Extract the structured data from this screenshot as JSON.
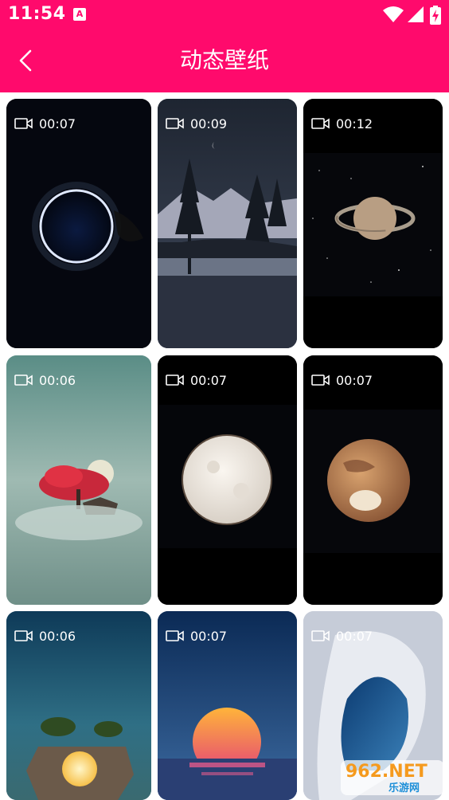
{
  "status_bar": {
    "time": "11:54",
    "notification": "A"
  },
  "header": {
    "title": "动态壁纸"
  },
  "wallpapers": [
    {
      "duration": "00:07",
      "subject": "planet-portal"
    },
    {
      "duration": "00:09",
      "subject": "mountain-lake-night"
    },
    {
      "duration": "00:12",
      "subject": "saturn"
    },
    {
      "duration": "00:06",
      "subject": "red-tree-moon"
    },
    {
      "duration": "00:07",
      "subject": "full-moon"
    },
    {
      "duration": "00:07",
      "subject": "mars"
    },
    {
      "duration": "00:06",
      "subject": "floating-island"
    },
    {
      "duration": "00:07",
      "subject": "sunset-sea"
    },
    {
      "duration": "00:07",
      "subject": "ocean-wave"
    }
  ],
  "watermark": {
    "line1": "962.NET",
    "line2": "乐游网"
  },
  "colors": {
    "accent": "#ff0a6c"
  }
}
